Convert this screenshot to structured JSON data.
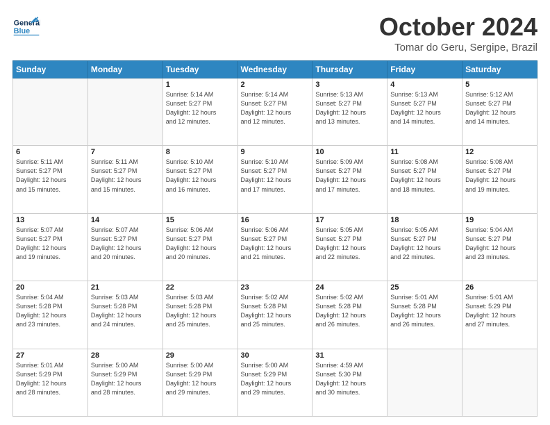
{
  "header": {
    "logo_line1": "General",
    "logo_line2": "Blue",
    "month_title": "October 2024",
    "location": "Tomar do Geru, Sergipe, Brazil"
  },
  "weekdays": [
    "Sunday",
    "Monday",
    "Tuesday",
    "Wednesday",
    "Thursday",
    "Friday",
    "Saturday"
  ],
  "weeks": [
    {
      "days": [
        {
          "num": "",
          "info": ""
        },
        {
          "num": "",
          "info": ""
        },
        {
          "num": "1",
          "info": "Sunrise: 5:14 AM\nSunset: 5:27 PM\nDaylight: 12 hours\nand 12 minutes."
        },
        {
          "num": "2",
          "info": "Sunrise: 5:14 AM\nSunset: 5:27 PM\nDaylight: 12 hours\nand 12 minutes."
        },
        {
          "num": "3",
          "info": "Sunrise: 5:13 AM\nSunset: 5:27 PM\nDaylight: 12 hours\nand 13 minutes."
        },
        {
          "num": "4",
          "info": "Sunrise: 5:13 AM\nSunset: 5:27 PM\nDaylight: 12 hours\nand 14 minutes."
        },
        {
          "num": "5",
          "info": "Sunrise: 5:12 AM\nSunset: 5:27 PM\nDaylight: 12 hours\nand 14 minutes."
        }
      ]
    },
    {
      "days": [
        {
          "num": "6",
          "info": "Sunrise: 5:11 AM\nSunset: 5:27 PM\nDaylight: 12 hours\nand 15 minutes."
        },
        {
          "num": "7",
          "info": "Sunrise: 5:11 AM\nSunset: 5:27 PM\nDaylight: 12 hours\nand 15 minutes."
        },
        {
          "num": "8",
          "info": "Sunrise: 5:10 AM\nSunset: 5:27 PM\nDaylight: 12 hours\nand 16 minutes."
        },
        {
          "num": "9",
          "info": "Sunrise: 5:10 AM\nSunset: 5:27 PM\nDaylight: 12 hours\nand 17 minutes."
        },
        {
          "num": "10",
          "info": "Sunrise: 5:09 AM\nSunset: 5:27 PM\nDaylight: 12 hours\nand 17 minutes."
        },
        {
          "num": "11",
          "info": "Sunrise: 5:08 AM\nSunset: 5:27 PM\nDaylight: 12 hours\nand 18 minutes."
        },
        {
          "num": "12",
          "info": "Sunrise: 5:08 AM\nSunset: 5:27 PM\nDaylight: 12 hours\nand 19 minutes."
        }
      ]
    },
    {
      "days": [
        {
          "num": "13",
          "info": "Sunrise: 5:07 AM\nSunset: 5:27 PM\nDaylight: 12 hours\nand 19 minutes."
        },
        {
          "num": "14",
          "info": "Sunrise: 5:07 AM\nSunset: 5:27 PM\nDaylight: 12 hours\nand 20 minutes."
        },
        {
          "num": "15",
          "info": "Sunrise: 5:06 AM\nSunset: 5:27 PM\nDaylight: 12 hours\nand 20 minutes."
        },
        {
          "num": "16",
          "info": "Sunrise: 5:06 AM\nSunset: 5:27 PM\nDaylight: 12 hours\nand 21 minutes."
        },
        {
          "num": "17",
          "info": "Sunrise: 5:05 AM\nSunset: 5:27 PM\nDaylight: 12 hours\nand 22 minutes."
        },
        {
          "num": "18",
          "info": "Sunrise: 5:05 AM\nSunset: 5:27 PM\nDaylight: 12 hours\nand 22 minutes."
        },
        {
          "num": "19",
          "info": "Sunrise: 5:04 AM\nSunset: 5:27 PM\nDaylight: 12 hours\nand 23 minutes."
        }
      ]
    },
    {
      "days": [
        {
          "num": "20",
          "info": "Sunrise: 5:04 AM\nSunset: 5:28 PM\nDaylight: 12 hours\nand 23 minutes."
        },
        {
          "num": "21",
          "info": "Sunrise: 5:03 AM\nSunset: 5:28 PM\nDaylight: 12 hours\nand 24 minutes."
        },
        {
          "num": "22",
          "info": "Sunrise: 5:03 AM\nSunset: 5:28 PM\nDaylight: 12 hours\nand 25 minutes."
        },
        {
          "num": "23",
          "info": "Sunrise: 5:02 AM\nSunset: 5:28 PM\nDaylight: 12 hours\nand 25 minutes."
        },
        {
          "num": "24",
          "info": "Sunrise: 5:02 AM\nSunset: 5:28 PM\nDaylight: 12 hours\nand 26 minutes."
        },
        {
          "num": "25",
          "info": "Sunrise: 5:01 AM\nSunset: 5:28 PM\nDaylight: 12 hours\nand 26 minutes."
        },
        {
          "num": "26",
          "info": "Sunrise: 5:01 AM\nSunset: 5:29 PM\nDaylight: 12 hours\nand 27 minutes."
        }
      ]
    },
    {
      "days": [
        {
          "num": "27",
          "info": "Sunrise: 5:01 AM\nSunset: 5:29 PM\nDaylight: 12 hours\nand 28 minutes."
        },
        {
          "num": "28",
          "info": "Sunrise: 5:00 AM\nSunset: 5:29 PM\nDaylight: 12 hours\nand 28 minutes."
        },
        {
          "num": "29",
          "info": "Sunrise: 5:00 AM\nSunset: 5:29 PM\nDaylight: 12 hours\nand 29 minutes."
        },
        {
          "num": "30",
          "info": "Sunrise: 5:00 AM\nSunset: 5:29 PM\nDaylight: 12 hours\nand 29 minutes."
        },
        {
          "num": "31",
          "info": "Sunrise: 4:59 AM\nSunset: 5:30 PM\nDaylight: 12 hours\nand 30 minutes."
        },
        {
          "num": "",
          "info": ""
        },
        {
          "num": "",
          "info": ""
        }
      ]
    }
  ]
}
